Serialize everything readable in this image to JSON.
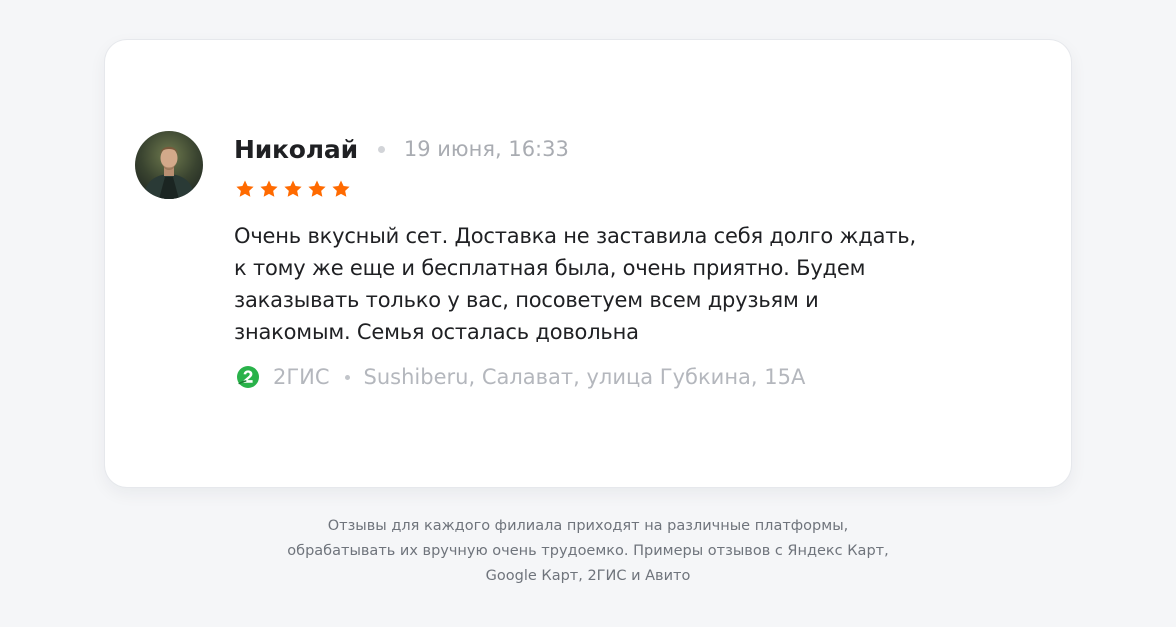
{
  "review": {
    "author": "Николай",
    "date": "19 июня, 16:33",
    "rating": 5,
    "rating_max": 5,
    "star_color": "#ff6a00",
    "avatar_icon": "user-photo-avatar",
    "text": "Очень вкусный сет. Доставка не заставила себя долго ждать, к тому же еще и бесплатная была, очень приятно. Будем заказывать только у вас, посоветуем всем друзьям и знакомым. Семья осталась довольна",
    "source": {
      "platform": "2ГИС",
      "platform_icon": "2gis-logo-icon",
      "platform_color": "#29b24a",
      "location": "Sushiberu, Салават, улица Губкина, 15А"
    }
  },
  "caption": {
    "lines": [
      "Отзывы для каждого филиала приходят на различные платформы,",
      "обрабатывать их вручную очень трудоемко. Примеры отзывов с Яндекс Карт,",
      "Google Карт, 2ГИС и Авито"
    ]
  }
}
